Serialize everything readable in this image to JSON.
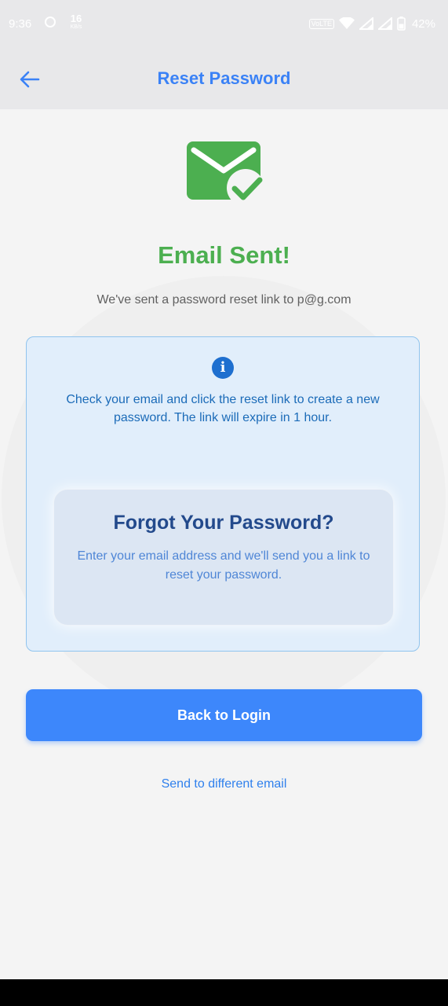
{
  "status_bar": {
    "time": "9:36",
    "speed_value": "16",
    "speed_unit": "KB/s",
    "volte_label": "VoLTE",
    "battery_percent": "42%"
  },
  "appbar": {
    "title": "Reset Password",
    "back_icon": "arrow-left-icon"
  },
  "confirmation": {
    "icon": "email-check-icon",
    "title": "Email Sent!",
    "subtitle": "We've sent a password reset link to p@g.com"
  },
  "info_card": {
    "icon": "info-icon",
    "text": "Check your email and click the reset link to create a new password. The link will expire in 1 hour.",
    "inner_card": {
      "title": "Forgot Your Password?",
      "description": "Enter your email address and we'll send you a link to reset your password."
    }
  },
  "actions": {
    "back_to_login": "Back to Login",
    "send_different_email": "Send to different email"
  },
  "colors": {
    "accent": "#3b82f6",
    "success": "#4caf50",
    "button": "#3d87fb",
    "card_background": "#e1eefb"
  }
}
